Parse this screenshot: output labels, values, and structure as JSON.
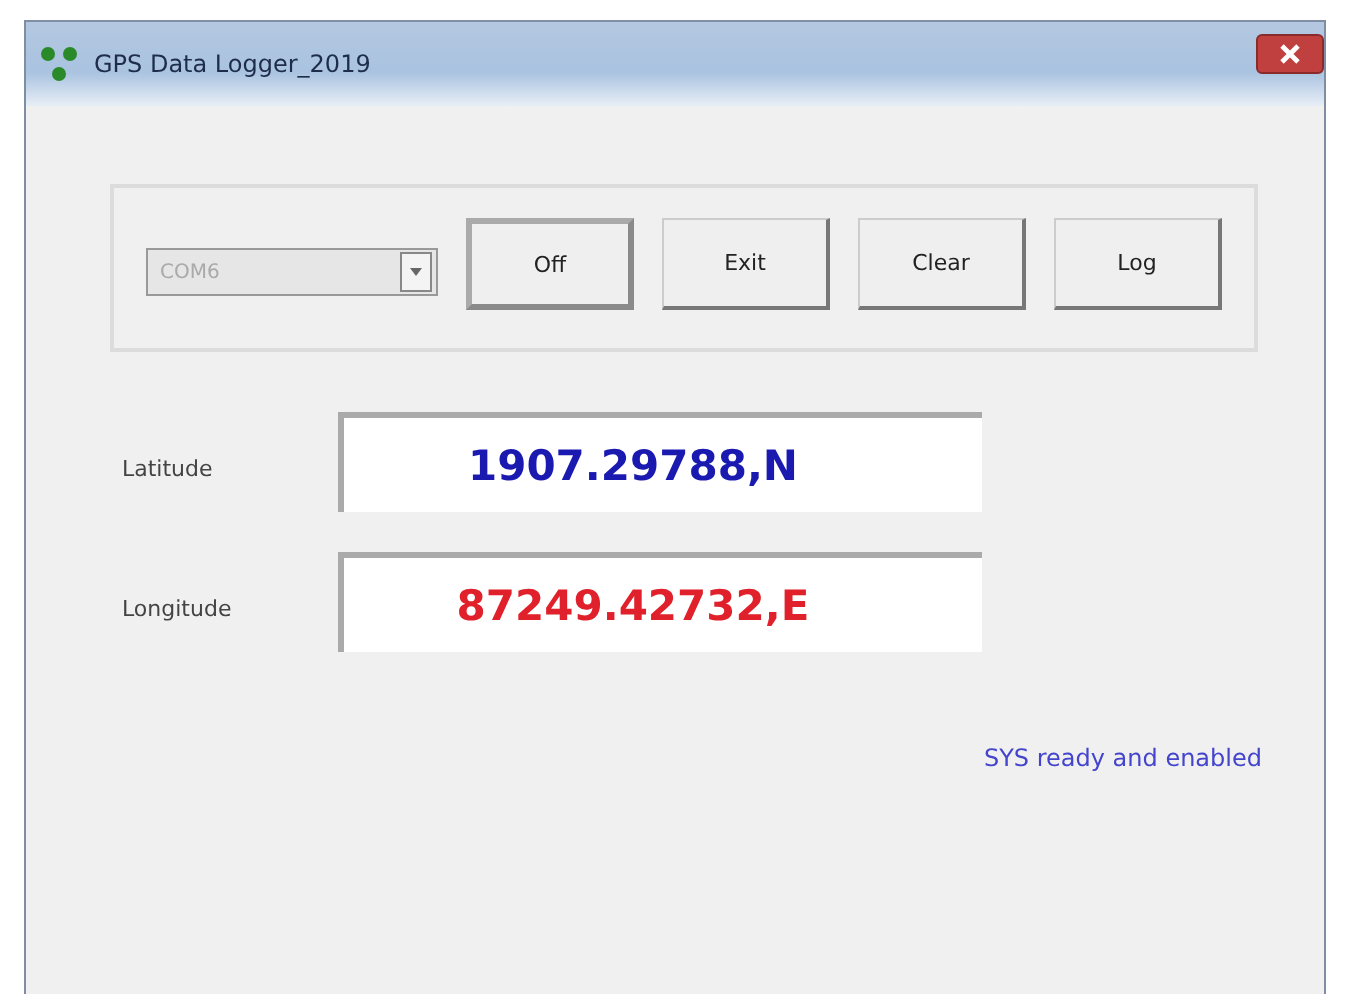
{
  "window": {
    "title": "GPS Data Logger_2019"
  },
  "port": {
    "value": "COM6",
    "disabled": true
  },
  "buttons": [
    {
      "label": "Off",
      "default": true
    },
    {
      "label": "Exit",
      "default": false
    },
    {
      "label": "Clear",
      "default": false
    },
    {
      "label": "Log",
      "default": false
    }
  ],
  "fields": [
    {
      "label": "Latitude",
      "value": "1907.29788,N",
      "color": "#1a1ab0"
    },
    {
      "label": "Longitude",
      "value": "87249.42732,E",
      "color": "#e0202a"
    }
  ],
  "status": "SYS ready and enabled"
}
